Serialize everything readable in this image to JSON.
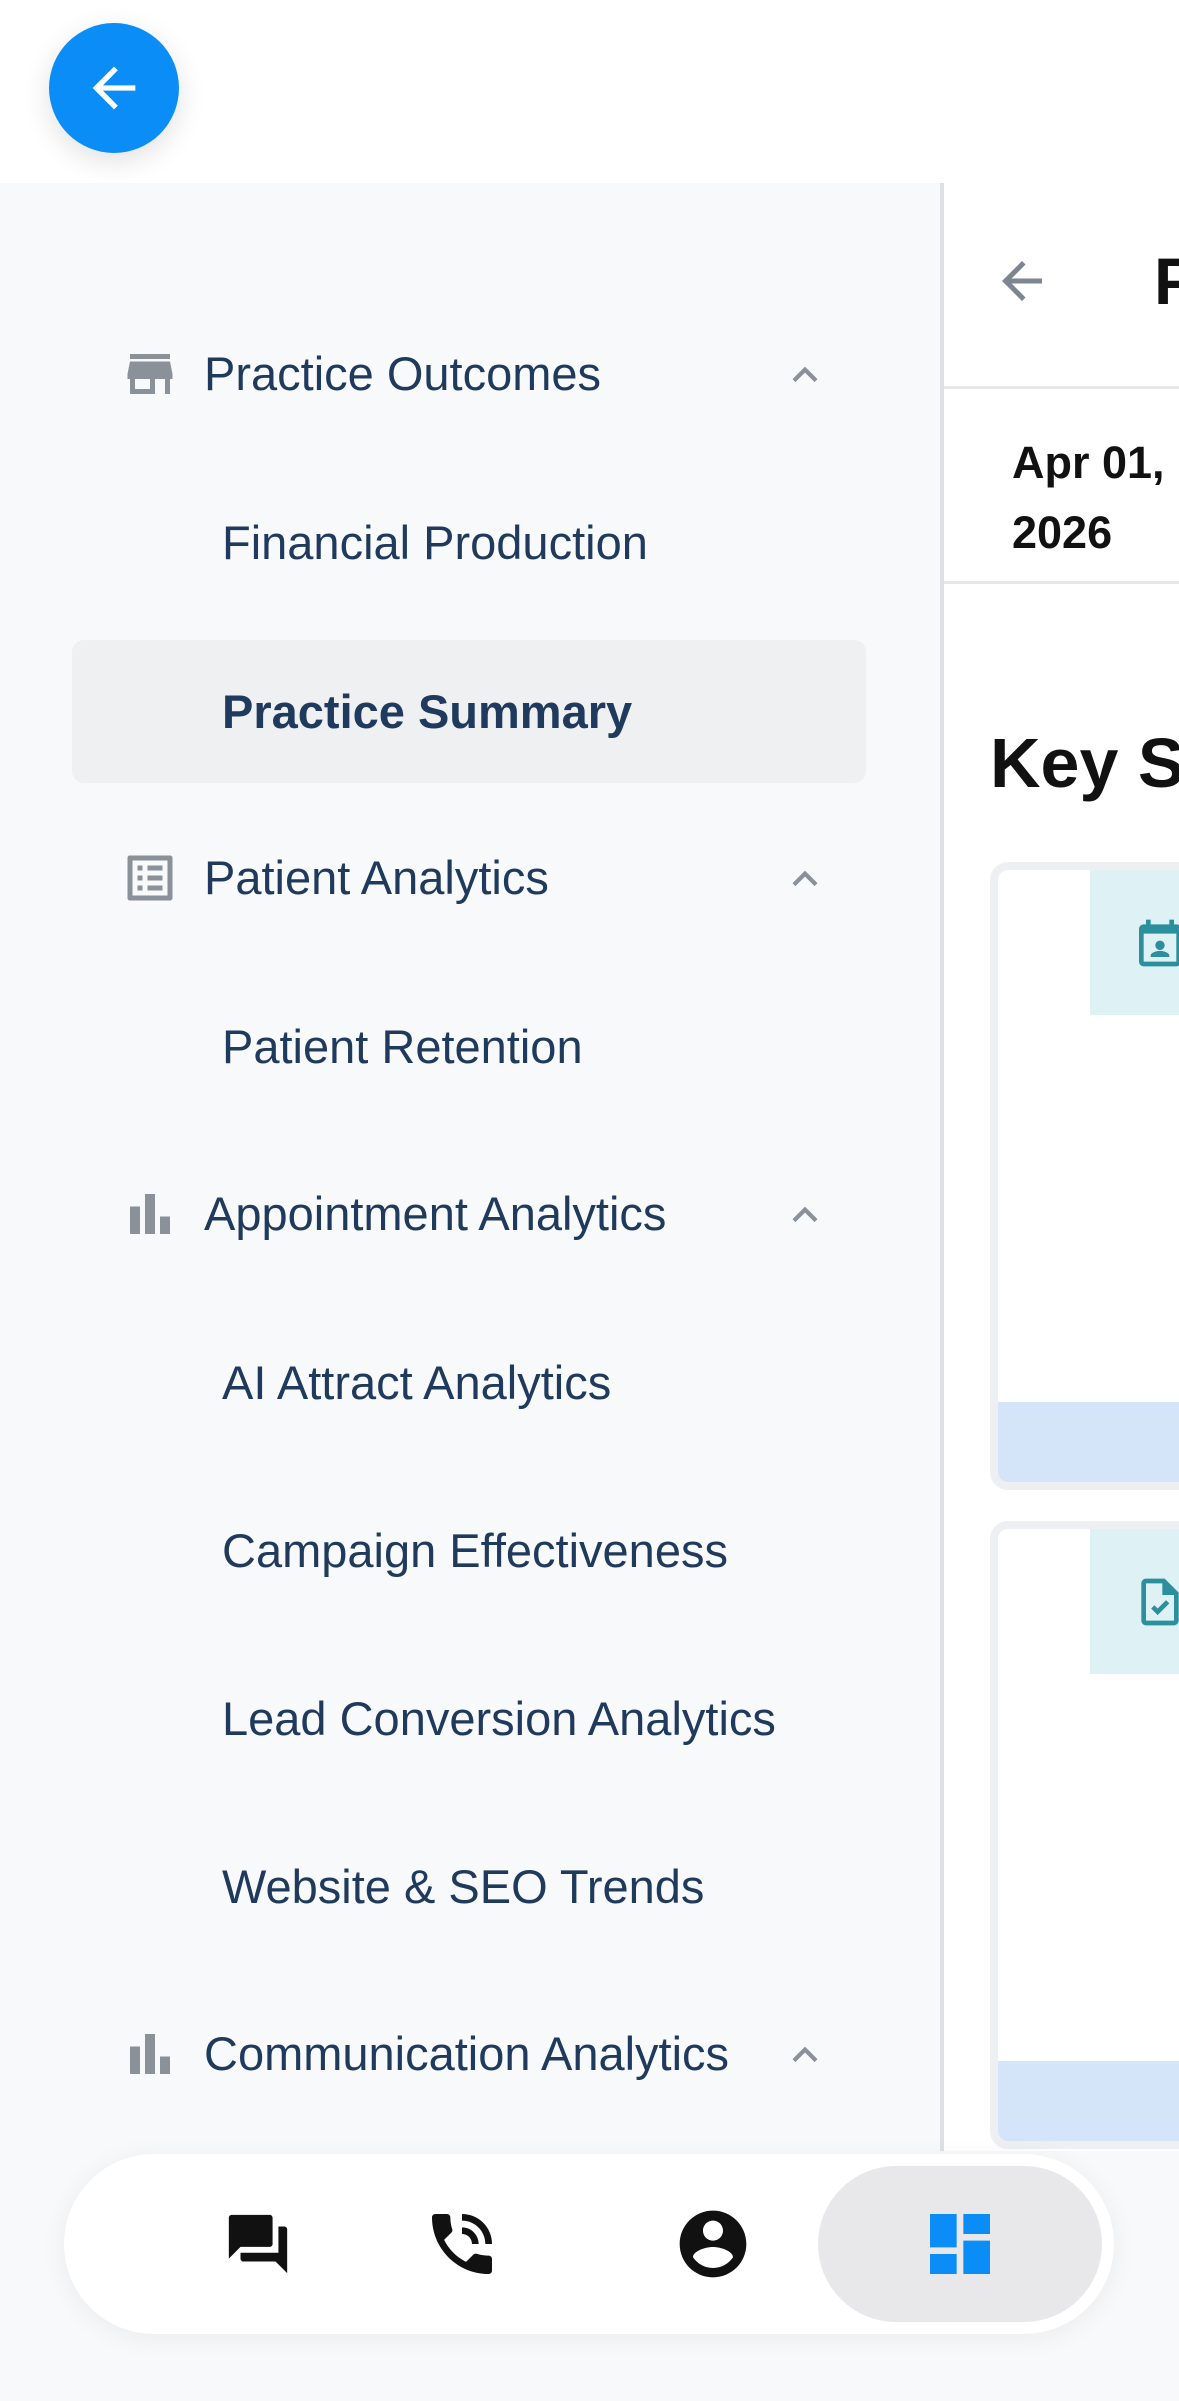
{
  "topbar": {
    "back_icon": "arrow-left-icon",
    "accent_color": "#0a8df7"
  },
  "sidebar": {
    "groups": [
      {
        "label": "Practice Outcomes",
        "icon": "store-icon",
        "expanded": true,
        "items": [
          {
            "label": "Financial Production",
            "active": false
          },
          {
            "label": "Practice Summary",
            "active": true
          }
        ]
      },
      {
        "label": "Patient Analytics",
        "icon": "list-icon",
        "expanded": true,
        "items": [
          {
            "label": "Patient Retention",
            "active": false
          }
        ]
      },
      {
        "label": "Appointment Analytics",
        "icon": "bar-chart-icon",
        "expanded": true,
        "items": [
          {
            "label": "AI Attract Analytics"
          },
          {
            "label": "Campaign Effectiveness"
          },
          {
            "label": "Lead Conversion Analytics"
          },
          {
            "label": "Website & SEO Trends"
          }
        ]
      },
      {
        "label": "Communication Analytics",
        "icon": "bar-chart-icon",
        "expanded": true,
        "items": []
      }
    ]
  },
  "content": {
    "title": "P",
    "date_text": "Apr 01, 2026",
    "section_title": "Key St",
    "cards": [
      {
        "icon": "contact-calendar-icon"
      },
      {
        "icon": "document-check-icon"
      }
    ]
  },
  "bottom_nav": {
    "items": [
      {
        "icon": "chat-icon",
        "active": false
      },
      {
        "icon": "phone-icon",
        "active": false
      },
      {
        "icon": "account-icon",
        "active": false
      },
      {
        "icon": "dashboard-icon",
        "active": true
      }
    ]
  }
}
